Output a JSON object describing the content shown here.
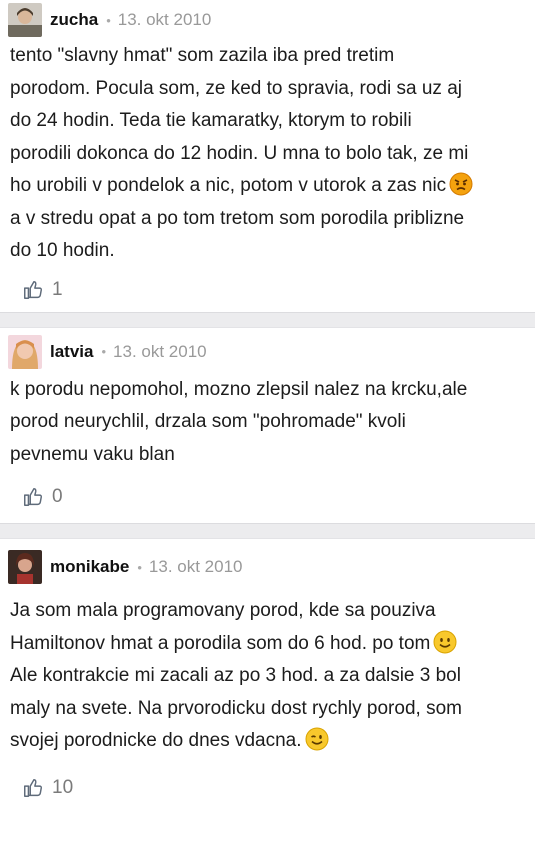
{
  "comments": [
    {
      "user": "zucha",
      "date": "13. okt 2010",
      "lines": [
        "tento \"slavny hmat\" som zazila iba pred tretim",
        "porodom. Pocula som, ze ked to spravia, rodi sa uz aj",
        "do 24 hodin. Teda tie kamaratky, ktorym to robili",
        "porodili dokonca do 12 hodin. U mna to bolo tak, ze mi",
        "ho urobili v pondelok a nic, potom v utorok a zas nic",
        "a v stredu opat a po tom tretom som porodila priblizne",
        "do 10 hodin."
      ],
      "emoji_line_4": "angry-face-icon",
      "likes": "1"
    },
    {
      "user": "latvia",
      "date": "13. okt 2010",
      "lines": [
        "k porodu nepomohol, mozno zlepsil nalez na krcku,ale",
        "porod neurychlil, drzala som \"pohromade\" kvoli",
        "pevnemu vaku blan"
      ],
      "likes": "0"
    },
    {
      "user": "monikabe",
      "date": "13. okt 2010",
      "lines": [
        "Ja som mala programovany porod, kde sa pouziva",
        "Hamiltonov hmat a porodila som do 6 hod. po tom",
        "Ale kontrakcie mi zacali az po 3 hod. a za dalsie 3 bol",
        "maly na svete. Na prvorodicku dost rychly porod, som",
        "svojej porodnicke do dnes vdacna."
      ],
      "emoji_line_1": "smile-face-icon",
      "emoji_line_4": "wink-face-icon",
      "likes": "10"
    }
  ],
  "separator": "•",
  "colors": {
    "separator_bg": "#ececee",
    "muted": "#999999"
  }
}
